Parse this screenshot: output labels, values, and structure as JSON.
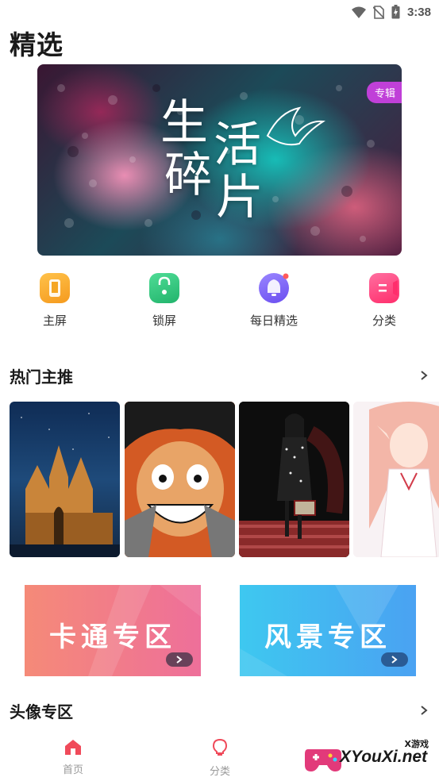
{
  "status_bar": {
    "time": "3:38",
    "icons": [
      "wifi-icon",
      "no-sim-icon",
      "battery-charging-icon"
    ]
  },
  "page": {
    "title": "精选"
  },
  "banner": {
    "title_chars": [
      "生",
      "活",
      "碎",
      "片"
    ],
    "badge": "专辑"
  },
  "shortcuts": [
    {
      "label": "主屏",
      "icon": "home-screen-icon",
      "color": "#f5a623"
    },
    {
      "label": "锁屏",
      "icon": "lock-screen-icon",
      "color": "#2ec27e"
    },
    {
      "label": "每日精选",
      "icon": "bell-icon",
      "color": "#7b61ff"
    },
    {
      "label": "分类",
      "icon": "category-icon",
      "color": "#ff3d78"
    }
  ],
  "hot": {
    "title": "热门主推",
    "thumbs": [
      "cathedral-night",
      "anime-pirate",
      "fashion-model",
      "anime-elf-girl"
    ]
  },
  "zones": [
    {
      "label": "卡通专区",
      "colors": [
        "#f58a78",
        "#ee6f9a"
      ]
    },
    {
      "label": "风景专区",
      "colors": [
        "#3ec8f0",
        "#4aa2f2"
      ]
    }
  ],
  "avatar_section": {
    "title": "头像专区"
  },
  "bottom_nav": [
    {
      "label": "首页",
      "icon": "home-icon",
      "active": true,
      "color": "#f04a5a"
    },
    {
      "label": "分类",
      "icon": "bulb-icon",
      "active": false,
      "color": "#f04a5a"
    }
  ],
  "watermark": {
    "text": "XYouXi.net",
    "small": "X游戏"
  }
}
